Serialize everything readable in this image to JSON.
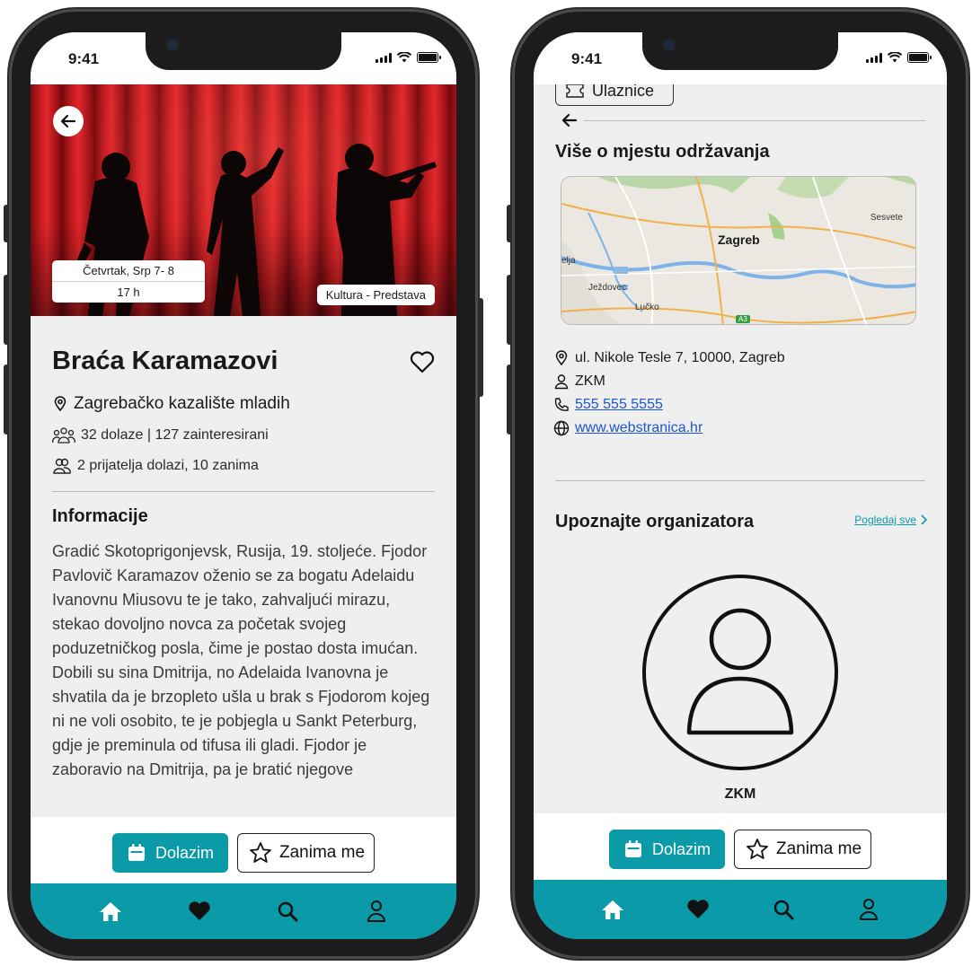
{
  "status": {
    "time": "9:41"
  },
  "event": {
    "date": "Četvrtak, Srp 7- 8",
    "time": "17 h",
    "category": "Kultura - Predstava",
    "title": "Braća Karamazovi",
    "venue": "Zagrebačko kazalište mladih",
    "attendance": "32 dolaze | 127 zainteresirani",
    "friends": "2 prijatelja dolazi, 10 zanima",
    "info_heading": "Informacije",
    "description": "Gradić Skotoprigonjevsk, Rusija, 19. stoljeće. Fjodor Pavlovič Karamazov oženio se za bogatu Adelaidu Ivanovnu Miusovu te je tako, zahvaljući mirazu, stekao dovoljno novca za početak svojeg poduzetničkog posla, čime je postao dosta imućan. Dobili su sina Dmitrija, no Adelaida Ivanovna je shvatila da je brzopleto ušla u brak s Fjodorom kojeg ni ne voli osobito, te je pobjegla u Sankt Peterburg, gdje je preminula od tifusa ili gladi. Fjodor je zaboravio na Dmitrija, pa je bratić njegove"
  },
  "actions": {
    "attend_label": "Dolazim",
    "interested_label": "Zanima me"
  },
  "venue_details": {
    "ticket_label": "Ulaznice",
    "heading": "Više o mjestu održavanja",
    "address": "ul. Nikole Tesle 7, 10000, Zagreb",
    "organizer_short": "ZKM",
    "phone": "555 555 5555",
    "website": "www.webstranica.hr"
  },
  "map": {
    "city": "Zagreb",
    "labels": [
      "Sesvete",
      "elja",
      "Ježdovec",
      "Lučko",
      "A3"
    ]
  },
  "organizer": {
    "heading": "Upoznajte organizatora",
    "see_all": "Pogledaj sve",
    "name": "ZKM"
  },
  "tabs": [
    "home",
    "favorites",
    "search",
    "profile"
  ],
  "colors": {
    "accent": "#0a9aa8",
    "curtain": "#c21a1f",
    "link": "#1a56d6"
  }
}
